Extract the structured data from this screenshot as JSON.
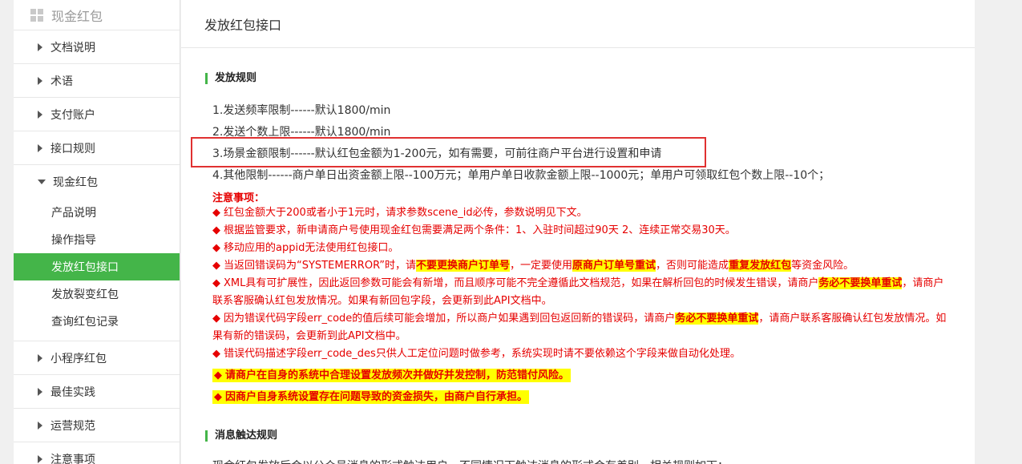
{
  "sidebar": {
    "header": "现金红包",
    "items_top": [
      "文档说明",
      "术语",
      "支付账户",
      "接口规则"
    ],
    "expanded": "现金红包",
    "subs": [
      "产品说明",
      "操作指导",
      "发放红包接口",
      "发放裂变红包",
      "查询红包记录"
    ],
    "items_bottom": [
      "小程序红包",
      "最佳实践",
      "运营规范",
      "注意事项"
    ]
  },
  "main": {
    "page_title": "发放红包接口",
    "section1": "发放规则",
    "rules": [
      "1.发送频率限制------默认1800/min",
      "2.发送个数上限------默认1800/min",
      "3.场景金额限制------默认红包金额为1-200元，如有需要，可前往商户平台进行设置和申请",
      "4.其他限制------商户单日出资金额上限--100万元；单用户单日收款金额上限--1000元；单用户可领取红包个数上限--10个；"
    ],
    "notes_title": "注意事项：",
    "notes": {
      "n1": "红包金额大于200或者小于1元时，请求参数scene_id必传，参数说明见下文。",
      "n2": "根据监管要求，新申请商户号使用现金红包需要满足两个条件：1、入驻时间超过90天 2、连续正常交易30天。",
      "n3": "移动应用的appid无法使用红包接口。",
      "n4_a": "当返回错误码为“SYSTEMERROR”时，请",
      "n4_b": "不要更换商户订单号",
      "n4_c": "，一定要使用",
      "n4_d": "原商户订单号重试",
      "n4_e": "，否则可能造成",
      "n4_f": "重复发放红包",
      "n4_g": "等资金风险。",
      "n5_a": "XML具有可扩展性，因此返回参数可能会有新增，而且顺序可能不完全遵循此文档规范，如果在解析回包的时候发生错误，请商户",
      "n5_b": "务必不要换单重试",
      "n5_c": "，请商户联系客服确认红包发放情况。如果有新回包字段，会更新到此API文档中。",
      "n6_a": "因为错误代码字段err_code的值后续可能会增加，所以商户如果遇到回包返回新的错误码，请商户",
      "n6_b": "务必不要换单重试",
      "n6_c": "，请商户联系客服确认红包发放情况。如果有新的错误码，会更新到此API文档中。",
      "n7": "错误代码描述字段err_code_des只供人工定位问题时做参考，系统实现时请不要依赖这个字段来做自动化处理。",
      "n8": "请商户在自身的系统中合理设置发放频次并做好并发控制，防范错付风险。",
      "n9": "因商户自身系统设置存在问题导致的资金损失，由商户自行承担。"
    },
    "bullet": "◆",
    "section2": "消息触达规则",
    "bottom_text": "现金红包发放后会以公众号消息的形式触达用户，不同情况下触达消息的形式会有差别，相关规则如下："
  }
}
